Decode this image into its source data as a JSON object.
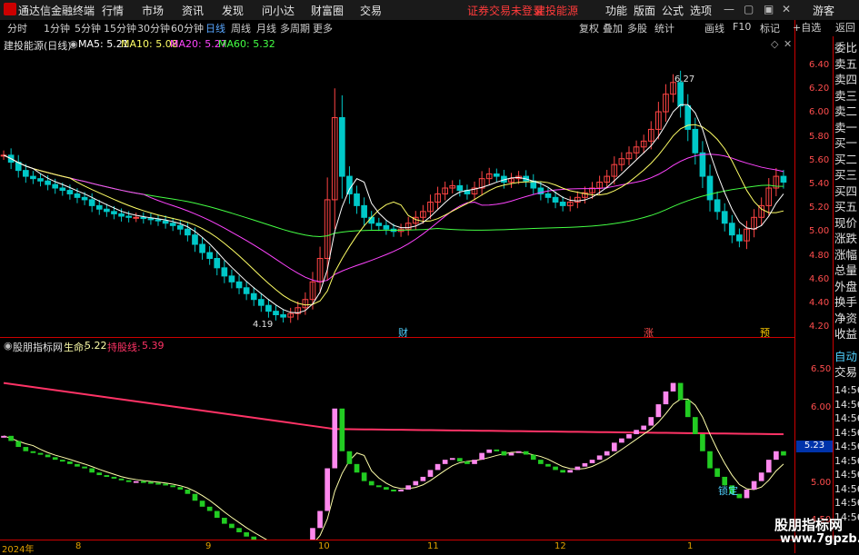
{
  "app": {
    "title": "通达信金融终端",
    "menu_left": [
      "行情",
      "市场",
      "资讯",
      "发现",
      "问小达",
      "财富圈",
      "交易"
    ],
    "alert_text": "证券交易未登录",
    "stock_link": "建投能源",
    "menu_right": [
      "功能",
      "版面",
      "公式",
      "选项"
    ],
    "guest": "游客"
  },
  "periods": [
    "分时",
    "1分钟",
    "5分钟",
    "15分钟",
    "30分钟",
    "60分钟",
    "日线",
    "周线",
    "月线",
    "多周期",
    "更多"
  ],
  "active_period": "日线",
  "toolbar": [
    "复权",
    "叠加",
    "多股",
    "统计",
    "画线",
    "F10",
    "标记",
    "+自选",
    "返回"
  ],
  "side_labels": [
    "委比",
    "卖五",
    "卖四",
    "卖三",
    "卖二",
    "卖一",
    "买一",
    "买二",
    "买三",
    "买四",
    "买五",
    "现价",
    "涨跌",
    "涨幅",
    "总量",
    "外盘",
    "换手",
    "净资",
    "收益"
  ],
  "sub_side_labels": [
    "自动",
    "交易"
  ],
  "sub_side_times": [
    "14:56",
    "14:56",
    "14:56",
    "14:56",
    "14:56",
    "14:56",
    "14:56",
    "14:56",
    "14:56",
    "14:56"
  ],
  "main_legend": {
    "name": "建投能源(日线)",
    "ma5": "MA5: 5.21",
    "ma10": "MA10: 5.08",
    "ma20": "MA20: 5.27",
    "ma60": "MA60: 5.32",
    "high_label": "6.27",
    "low_label": "4.19"
  },
  "main_axis": [
    "6.40",
    "6.20",
    "6.00",
    "5.80",
    "5.60",
    "5.40",
    "5.20",
    "5.00",
    "4.80",
    "4.60",
    "4.40",
    "4.20"
  ],
  "event_marks": [
    "财",
    "涨",
    "预"
  ],
  "sub_legend": {
    "name": "股朋指标网",
    "life_label": "生命:",
    "life_value": "5.22",
    "hold_label": "持股线:",
    "hold_value": "5.39",
    "lock_label": "锁定"
  },
  "sub_axis": [
    "6.50",
    "6.00",
    "5.50",
    "5.00",
    "4.50"
  ],
  "sub_current": "5.23",
  "x_axis": [
    "2024年",
    "8",
    "9",
    "10",
    "11",
    "12",
    "1"
  ],
  "watermark": {
    "name": "股朋指标网",
    "url": "www.7gpzb.com"
  },
  "colors": {
    "ma5": "#ffffff",
    "ma10": "#ffff66",
    "ma20": "#ff44ff",
    "ma60": "#44ff44",
    "up": "#ff4444",
    "down": "#00c8c8",
    "hold_line": "#ff3366",
    "life_line": "#ffffaa"
  },
  "chart_data": {
    "type": "candlestick",
    "main_axis_range": [
      4.1,
      6.5
    ],
    "closes": [
      5.58,
      5.52,
      5.45,
      5.4,
      5.38,
      5.36,
      5.33,
      5.3,
      5.28,
      5.25,
      5.22,
      5.2,
      5.15,
      5.12,
      5.1,
      5.08,
      5.06,
      5.05,
      5.05,
      5.04,
      5.03,
      5.02,
      5.0,
      4.98,
      4.95,
      4.9,
      4.82,
      4.75,
      4.7,
      4.62,
      4.55,
      4.5,
      4.45,
      4.4,
      4.35,
      4.3,
      4.25,
      4.22,
      4.2,
      4.23,
      4.28,
      4.35,
      4.5,
      4.7,
      5.2,
      5.9,
      5.4,
      5.25,
      5.15,
      5.05,
      5.0,
      4.98,
      4.95,
      4.93,
      4.95,
      5.0,
      5.05,
      5.1,
      5.18,
      5.25,
      5.3,
      5.32,
      5.28,
      5.25,
      5.3,
      5.38,
      5.42,
      5.4,
      5.35,
      5.38,
      5.4,
      5.36,
      5.3,
      5.25,
      5.22,
      5.18,
      5.15,
      5.18,
      5.22,
      5.26,
      5.3,
      5.35,
      5.4,
      5.5,
      5.55,
      5.6,
      5.65,
      5.7,
      5.8,
      5.95,
      6.1,
      6.2,
      6.0,
      5.8,
      5.6,
      5.4,
      5.2,
      5.1,
      5.0,
      4.9,
      4.85,
      4.95,
      5.05,
      5.15,
      5.3,
      5.4,
      5.35
    ]
  }
}
